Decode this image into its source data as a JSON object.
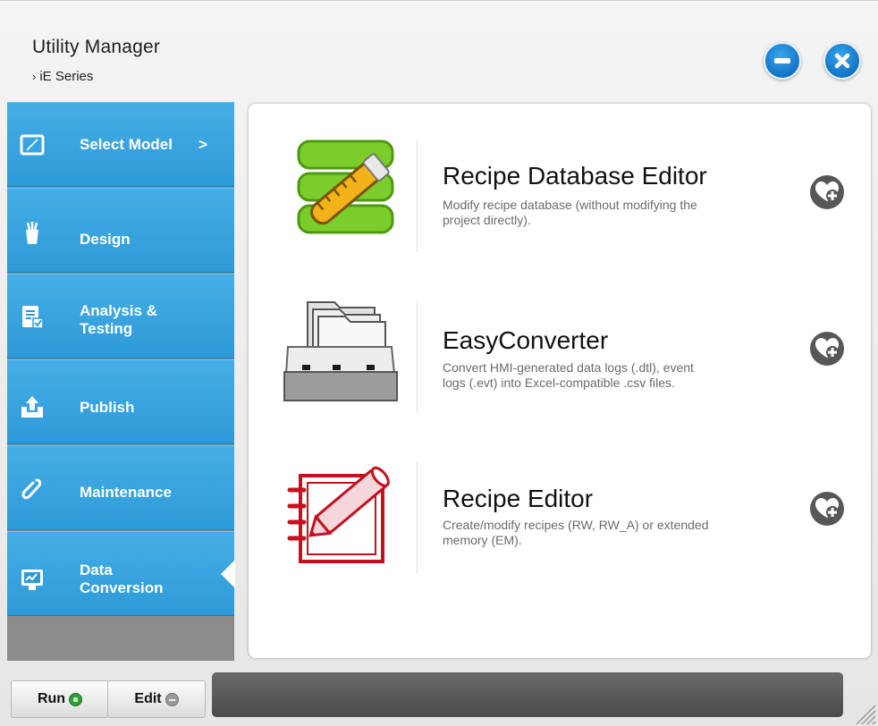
{
  "window": {
    "title": "Utility Manager",
    "subtitle": "iE Series",
    "subtitle_chevron": "›",
    "minimize_icon": "minimize-icon",
    "close_icon": "close-icon",
    "accent": "#2d9ad8"
  },
  "sidebar": {
    "items": [
      {
        "label_lines": [
          "Select Model"
        ],
        "chevron": ">",
        "icon": "monitor-icon",
        "active": false
      },
      {
        "label_lines": [
          "Design"
        ],
        "icon": "pencil-cup-icon",
        "active": false
      },
      {
        "label_lines": [
          "Analysis &",
          "Testing"
        ],
        "icon": "checklist-icon",
        "active": false
      },
      {
        "label_lines": [
          "Publish"
        ],
        "icon": "upload-icon",
        "active": false
      },
      {
        "label_lines": [
          "Maintenance"
        ],
        "icon": "paperclip-icon",
        "active": false
      },
      {
        "label_lines": [
          "Data",
          "Conversion"
        ],
        "icon": "data-conversion-icon",
        "active": true
      }
    ]
  },
  "tools": [
    {
      "name": "Recipe Database Editor",
      "desc_lines": [
        "Modify recipe database (without modifying the",
        "project directly)."
      ],
      "icon": "database-test-tube-icon"
    },
    {
      "name": "EasyConverter",
      "desc_lines": [
        "Convert HMI-generated data logs (.dtl), event",
        "logs (.evt) into Excel-compatible .csv files."
      ],
      "icon": "file-drawer-icon"
    },
    {
      "name": "Recipe Editor",
      "desc_lines": [
        "Create/modify recipes (RW, RW_A) or extended",
        "memory (EM)."
      ],
      "icon": "notebook-pen-icon"
    }
  ],
  "footer": {
    "run_label": "Run",
    "edit_label": "Edit",
    "run_active": true
  }
}
